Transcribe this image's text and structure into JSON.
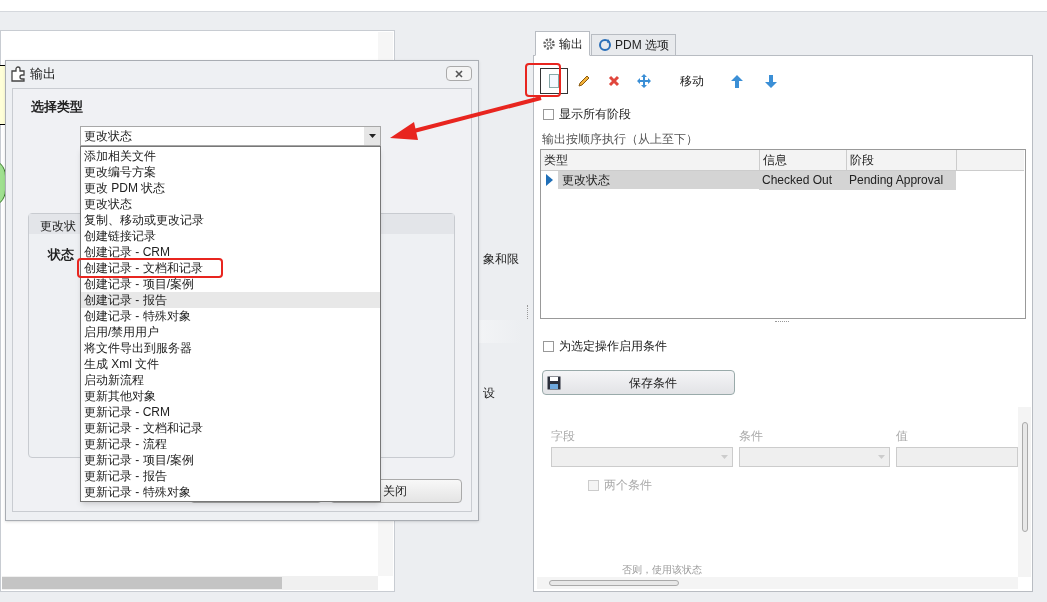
{
  "background_fragments": [
    "象和限",
    "设"
  ],
  "dialog": {
    "title": "输出",
    "section_label": "选择类型",
    "type_dropdown": {
      "value": "更改状态",
      "options": [
        {
          "label": "添加相关文件",
          "highlighted": false,
          "boxed": false
        },
        {
          "label": "更改编号方案",
          "highlighted": false,
          "boxed": false
        },
        {
          "label": "更改 PDM 状态",
          "highlighted": false,
          "boxed": false
        },
        {
          "label": "更改状态",
          "highlighted": false,
          "boxed": false
        },
        {
          "label": "复制、移动或更改记录",
          "highlighted": false,
          "boxed": false
        },
        {
          "label": "创建链接记录",
          "highlighted": false,
          "boxed": false
        },
        {
          "label": "创建记录 - CRM",
          "highlighted": false,
          "boxed": false
        },
        {
          "label": "创建记录 - 文档和记录",
          "highlighted": false,
          "boxed": true
        },
        {
          "label": "创建记录 - 项目/案例",
          "highlighted": false,
          "boxed": false
        },
        {
          "label": "创建记录 - 报告",
          "highlighted": true,
          "boxed": false
        },
        {
          "label": "创建记录 - 特殊对象",
          "highlighted": false,
          "boxed": false
        },
        {
          "label": "启用/禁用用户",
          "highlighted": false,
          "boxed": false
        },
        {
          "label": "将文件导出到服务器",
          "highlighted": false,
          "boxed": false
        },
        {
          "label": "生成 Xml 文件",
          "highlighted": false,
          "boxed": false
        },
        {
          "label": "启动新流程",
          "highlighted": false,
          "boxed": false
        },
        {
          "label": "更新其他对象",
          "highlighted": false,
          "boxed": false
        },
        {
          "label": "更新记录 - CRM",
          "highlighted": false,
          "boxed": false
        },
        {
          "label": "更新记录 - 文档和记录",
          "highlighted": false,
          "boxed": false
        },
        {
          "label": "更新记录 - 流程",
          "highlighted": false,
          "boxed": false
        },
        {
          "label": "更新记录 - 项目/案例",
          "highlighted": false,
          "boxed": false
        },
        {
          "label": "更新记录 - 报告",
          "highlighted": false,
          "boxed": false
        },
        {
          "label": "更新记录 - 特殊对象",
          "highlighted": false,
          "boxed": false
        }
      ]
    },
    "group_tab": "更改状",
    "state_label": "状态",
    "close_button": "关闭"
  },
  "tabs": [
    {
      "label": "输出",
      "selected": true
    },
    {
      "label": "PDM 选项",
      "selected": false
    }
  ],
  "toolbar": [
    {
      "kind": "new",
      "boxed": true
    },
    {
      "kind": "edit",
      "boxed": false
    },
    {
      "kind": "delete",
      "boxed": false
    },
    {
      "kind": "move",
      "boxed": false
    },
    {
      "kind": "label",
      "text": "移动",
      "boxed": false
    },
    {
      "kind": "up",
      "boxed": false
    },
    {
      "kind": "down",
      "boxed": false
    }
  ],
  "show_all_stages": {
    "label": "显示所有阶段",
    "checked": false
  },
  "outputs_caption": "输出按顺序执行（从上至下）",
  "table": {
    "columns": [
      "类型",
      "信息",
      "阶段"
    ],
    "rows": [
      {
        "cells": [
          "更改状态",
          "Checked Out",
          "Pending Approval"
        ],
        "selected": true
      }
    ]
  },
  "enable_conditions": {
    "label": "为选定操作启用条件",
    "checked": false
  },
  "save_button": "保存条件",
  "conditions": {
    "disabled": true,
    "labels": [
      "字段",
      "条件",
      "值"
    ],
    "two_conditions": {
      "label": "两个条件",
      "checked": false
    },
    "else_text": "否则，使用该状态"
  }
}
